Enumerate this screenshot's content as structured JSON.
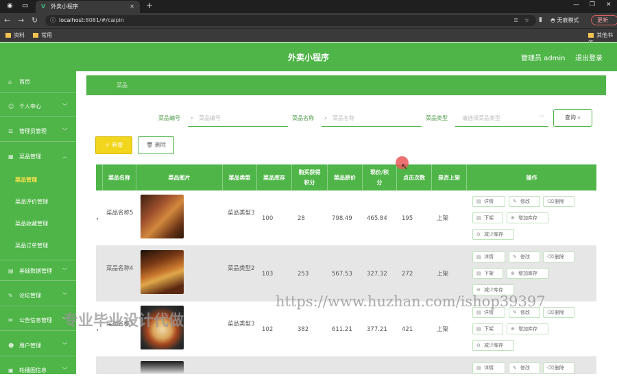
{
  "browser": {
    "tab_title": "外卖小程序",
    "url_host": "localhost",
    "url_rest": ":8081/#/caipin",
    "incognito_label": "无痕模式",
    "update_label": "更新",
    "bookmarks": [
      "资料",
      "常用"
    ],
    "bookmark_right": "其他书签"
  },
  "header": {
    "title": "外卖小程序",
    "admin": "管理员 admin",
    "logout": "退出登录"
  },
  "sidebar": {
    "menus": [
      {
        "label": "首页",
        "icon": "home-icon"
      },
      {
        "label": "个人中心",
        "icon": "user-icon"
      },
      {
        "label": "管理员管理",
        "icon": "admin-icon"
      },
      {
        "label": "菜品管理",
        "icon": "dish-icon"
      }
    ],
    "submenus": [
      "菜品管理",
      "菜品评价管理",
      "菜品收藏管理",
      "菜品订单管理"
    ],
    "menus_after": [
      {
        "label": "基础数据管理",
        "icon": "data-icon"
      },
      {
        "label": "论坛管理",
        "icon": "forum-icon"
      },
      {
        "label": "公告信息管理",
        "icon": "notice-icon"
      },
      {
        "label": "用户管理",
        "icon": "users-icon"
      },
      {
        "label": "轮播图信息",
        "icon": "carousel-icon"
      }
    ]
  },
  "breadcrumb": "菜品",
  "filters": {
    "code_label": "菜品编号",
    "code_placeholder": "菜品编号",
    "name_label": "菜品名称",
    "name_placeholder": "菜品名称",
    "type_label": "菜品类型",
    "type_placeholder": "请选择菜品类型",
    "query_label": "查询"
  },
  "actions": {
    "add_label": "新增",
    "delete_label": "删除"
  },
  "table": {
    "headers": [
      "菜品名称",
      "菜品图片",
      "菜品类型",
      "菜品库存",
      "购买获得积分",
      "菜品原价",
      "现价/积分",
      "点击次数",
      "是否上架",
      "操作"
    ],
    "rows": [
      {
        "name": "菜品名称5",
        "type": "菜品类型3",
        "stock": "100",
        "points": "28",
        "orig": "798.49",
        "now": "465.84",
        "clicks": "195",
        "shelf": "上架"
      },
      {
        "name": "菜品名称4",
        "type": "菜品类型2",
        "stock": "103",
        "points": "253",
        "orig": "567.53",
        "now": "327.32",
        "clicks": "272",
        "shelf": "上架"
      },
      {
        "name": "菜品名称3",
        "type": "菜品类型3",
        "stock": "102",
        "points": "382",
        "orig": "611.21",
        "now": "377.21",
        "clicks": "421",
        "shelf": "上架"
      },
      {
        "name": "",
        "type": "",
        "stock": "",
        "points": "",
        "orig": "",
        "now": "",
        "clicks": "",
        "shelf": ""
      }
    ],
    "op_labels": {
      "detail": "详情",
      "edit": "修改",
      "delete": "删除",
      "off_shelf": "下架",
      "add_stock": "增加库存",
      "reduce_stock": "减少库存"
    }
  },
  "watermarks": {
    "url": "https://www.huzhan.com/ishop39397",
    "text": "专业毕业设计代做"
  },
  "colors": {
    "primary": "#4fb548",
    "accent": "#f2d51d",
    "alt_row": "#e6e6e6"
  }
}
